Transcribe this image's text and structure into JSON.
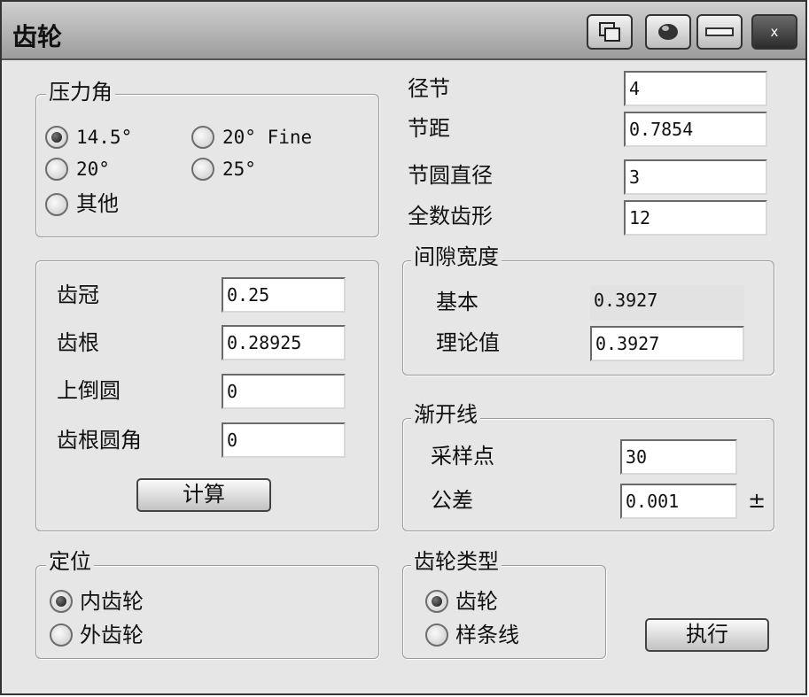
{
  "window": {
    "title": "齿轮"
  },
  "title_buttons": {
    "close_label": "x"
  },
  "pressure_angle": {
    "legend": "压力角",
    "options": [
      "14.5°",
      "20° Fine",
      "20°",
      "25°",
      "其他"
    ],
    "selected": "14.5°"
  },
  "params": {
    "diametral_pitch": {
      "label": "径节",
      "value": "4"
    },
    "circular_pitch": {
      "label": "节距",
      "value": "0.7854"
    },
    "pitch_diameter": {
      "label": "节圆直径",
      "value": "3"
    },
    "teeth": {
      "label": "全数齿形",
      "value": "12"
    }
  },
  "tooth": {
    "addendum": {
      "label": "齿冠",
      "value": "0.25"
    },
    "dedendum": {
      "label": "齿根",
      "value": "0.28925"
    },
    "top_fillet": {
      "label": "上倒圆",
      "value": "0"
    },
    "root_fillet": {
      "label": "齿根圆角",
      "value": "0"
    },
    "calc_button": "计算"
  },
  "clearance": {
    "legend": "间隙宽度",
    "basic": {
      "label": "基本",
      "value": "0.3927"
    },
    "theoretical": {
      "label": "理论值",
      "value": "0.3927"
    }
  },
  "involute": {
    "legend": "渐开线",
    "samples": {
      "label": "采样点",
      "value": "30"
    },
    "tolerance": {
      "label": "公差",
      "value": "0.001"
    },
    "pm": "±"
  },
  "positioning": {
    "legend": "定位",
    "options": [
      "内齿轮",
      "外齿轮"
    ],
    "selected": "内齿轮"
  },
  "gear_type": {
    "legend": "齿轮类型",
    "options": [
      "齿轮",
      "样条线"
    ],
    "selected": "齿轮"
  },
  "execute_button": "执行"
}
